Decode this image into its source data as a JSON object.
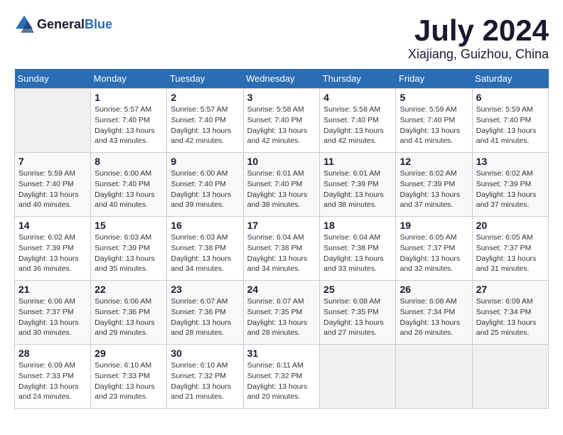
{
  "header": {
    "logo_general": "General",
    "logo_blue": "Blue",
    "month": "July 2024",
    "location": "Xiajiang, Guizhou, China"
  },
  "weekdays": [
    "Sunday",
    "Monday",
    "Tuesday",
    "Wednesday",
    "Thursday",
    "Friday",
    "Saturday"
  ],
  "weeks": [
    [
      {
        "day": "",
        "info": ""
      },
      {
        "day": "1",
        "info": "Sunrise: 5:57 AM\nSunset: 7:40 PM\nDaylight: 13 hours\nand 43 minutes."
      },
      {
        "day": "2",
        "info": "Sunrise: 5:57 AM\nSunset: 7:40 PM\nDaylight: 13 hours\nand 42 minutes."
      },
      {
        "day": "3",
        "info": "Sunrise: 5:58 AM\nSunset: 7:40 PM\nDaylight: 13 hours\nand 42 minutes."
      },
      {
        "day": "4",
        "info": "Sunrise: 5:58 AM\nSunset: 7:40 PM\nDaylight: 13 hours\nand 42 minutes."
      },
      {
        "day": "5",
        "info": "Sunrise: 5:59 AM\nSunset: 7:40 PM\nDaylight: 13 hours\nand 41 minutes."
      },
      {
        "day": "6",
        "info": "Sunrise: 5:59 AM\nSunset: 7:40 PM\nDaylight: 13 hours\nand 41 minutes."
      }
    ],
    [
      {
        "day": "7",
        "info": "Sunrise: 5:59 AM\nSunset: 7:40 PM\nDaylight: 13 hours\nand 40 minutes."
      },
      {
        "day": "8",
        "info": "Sunrise: 6:00 AM\nSunset: 7:40 PM\nDaylight: 13 hours\nand 40 minutes."
      },
      {
        "day": "9",
        "info": "Sunrise: 6:00 AM\nSunset: 7:40 PM\nDaylight: 13 hours\nand 39 minutes."
      },
      {
        "day": "10",
        "info": "Sunrise: 6:01 AM\nSunset: 7:40 PM\nDaylight: 13 hours\nand 38 minutes."
      },
      {
        "day": "11",
        "info": "Sunrise: 6:01 AM\nSunset: 7:39 PM\nDaylight: 13 hours\nand 38 minutes."
      },
      {
        "day": "12",
        "info": "Sunrise: 6:02 AM\nSunset: 7:39 PM\nDaylight: 13 hours\nand 37 minutes."
      },
      {
        "day": "13",
        "info": "Sunrise: 6:02 AM\nSunset: 7:39 PM\nDaylight: 13 hours\nand 37 minutes."
      }
    ],
    [
      {
        "day": "14",
        "info": "Sunrise: 6:02 AM\nSunset: 7:39 PM\nDaylight: 13 hours\nand 36 minutes."
      },
      {
        "day": "15",
        "info": "Sunrise: 6:03 AM\nSunset: 7:39 PM\nDaylight: 13 hours\nand 35 minutes."
      },
      {
        "day": "16",
        "info": "Sunrise: 6:03 AM\nSunset: 7:38 PM\nDaylight: 13 hours\nand 34 minutes."
      },
      {
        "day": "17",
        "info": "Sunrise: 6:04 AM\nSunset: 7:38 PM\nDaylight: 13 hours\nand 34 minutes."
      },
      {
        "day": "18",
        "info": "Sunrise: 6:04 AM\nSunset: 7:38 PM\nDaylight: 13 hours\nand 33 minutes."
      },
      {
        "day": "19",
        "info": "Sunrise: 6:05 AM\nSunset: 7:37 PM\nDaylight: 13 hours\nand 32 minutes."
      },
      {
        "day": "20",
        "info": "Sunrise: 6:05 AM\nSunset: 7:37 PM\nDaylight: 13 hours\nand 31 minutes."
      }
    ],
    [
      {
        "day": "21",
        "info": "Sunrise: 6:06 AM\nSunset: 7:37 PM\nDaylight: 13 hours\nand 30 minutes."
      },
      {
        "day": "22",
        "info": "Sunrise: 6:06 AM\nSunset: 7:36 PM\nDaylight: 13 hours\nand 29 minutes."
      },
      {
        "day": "23",
        "info": "Sunrise: 6:07 AM\nSunset: 7:36 PM\nDaylight: 13 hours\nand 28 minutes."
      },
      {
        "day": "24",
        "info": "Sunrise: 6:07 AM\nSunset: 7:35 PM\nDaylight: 13 hours\nand 28 minutes."
      },
      {
        "day": "25",
        "info": "Sunrise: 6:08 AM\nSunset: 7:35 PM\nDaylight: 13 hours\nand 27 minutes."
      },
      {
        "day": "26",
        "info": "Sunrise: 6:08 AM\nSunset: 7:34 PM\nDaylight: 13 hours\nand 26 minutes."
      },
      {
        "day": "27",
        "info": "Sunrise: 6:09 AM\nSunset: 7:34 PM\nDaylight: 13 hours\nand 25 minutes."
      }
    ],
    [
      {
        "day": "28",
        "info": "Sunrise: 6:09 AM\nSunset: 7:33 PM\nDaylight: 13 hours\nand 24 minutes."
      },
      {
        "day": "29",
        "info": "Sunrise: 6:10 AM\nSunset: 7:33 PM\nDaylight: 13 hours\nand 23 minutes."
      },
      {
        "day": "30",
        "info": "Sunrise: 6:10 AM\nSunset: 7:32 PM\nDaylight: 13 hours\nand 21 minutes."
      },
      {
        "day": "31",
        "info": "Sunrise: 6:11 AM\nSunset: 7:32 PM\nDaylight: 13 hours\nand 20 minutes."
      },
      {
        "day": "",
        "info": ""
      },
      {
        "day": "",
        "info": ""
      },
      {
        "day": "",
        "info": ""
      }
    ]
  ]
}
